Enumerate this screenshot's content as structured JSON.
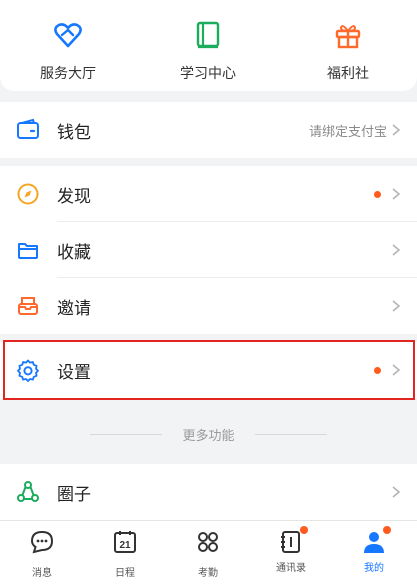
{
  "quick_actions": [
    {
      "label": "服务大厅",
      "icon": "heart-service-icon",
      "color": "#1677ff"
    },
    {
      "label": "学习中心",
      "icon": "book-icon",
      "color": "#1aad5b"
    },
    {
      "label": "福利社",
      "icon": "gift-icon",
      "color": "#ff6a2c"
    }
  ],
  "wallet": {
    "label": "钱包",
    "value": "请绑定支付宝",
    "icon": "wallet-icon"
  },
  "menu": {
    "discover": {
      "label": "发现",
      "icon": "compass-icon",
      "has_dot": true
    },
    "favorites": {
      "label": "收藏",
      "icon": "folder-icon",
      "has_dot": false
    },
    "invite": {
      "label": "邀请",
      "icon": "invite-box-icon",
      "has_dot": false
    }
  },
  "settings": {
    "label": "设置",
    "icon": "gear-icon",
    "has_dot": true,
    "highlighted": true
  },
  "more_features": {
    "label": "更多功能"
  },
  "circle": {
    "label": "圈子",
    "icon": "circle-group-icon"
  },
  "tabbar": {
    "messages": {
      "label": "消息",
      "icon": "chat-icon"
    },
    "calendar": {
      "label": "日程",
      "icon": "calendar-icon",
      "day": "21"
    },
    "attendance": {
      "label": "考勤",
      "icon": "grid-icon"
    },
    "contacts": {
      "label": "通讯录",
      "icon": "contacts-icon",
      "has_dot": true
    },
    "me": {
      "label": "我的",
      "icon": "person-icon",
      "active": true,
      "has_dot": true
    }
  },
  "colors": {
    "accent": "#1677ff",
    "dot": "#ff5a1f",
    "highlight": "#e2261f"
  }
}
